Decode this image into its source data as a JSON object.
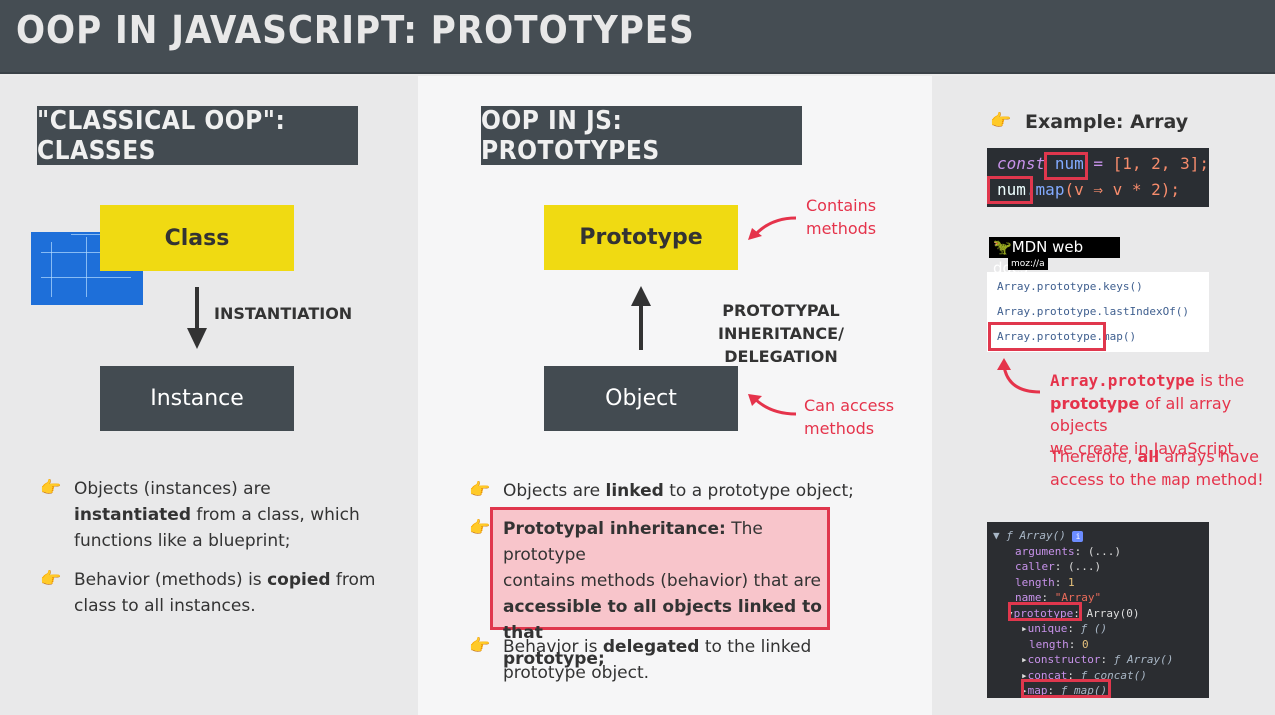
{
  "header": {
    "title": "OOP IN JAVASCRIPT: PROTOTYPES"
  },
  "left": {
    "banner": "\"CLASSICAL OOP\": CLASSES",
    "class_box": "Class",
    "arrow_label": "INSTANTIATION",
    "instance_box": "Instance",
    "bullet1": {
      "p1": "Objects (instances) are",
      "b1": "instantiated",
      "p2": "from a class, which",
      "p3": "functions like a blueprint;"
    },
    "bullet2": {
      "p1": "Behavior (methods) is",
      "b1": "copied",
      "p2": "from",
      "p3": "class to all instances."
    }
  },
  "middle": {
    "banner": "OOP IN JS: PROTOTYPES",
    "prototype_box": "Prototype",
    "object_box": "Object",
    "arrow_label_1": "PROTOTYPAL INHERITANCE/",
    "arrow_label_2": "DELEGATION",
    "contains_1": "Contains",
    "contains_2": "methods",
    "access_1": "Can access",
    "access_2": "methods",
    "bullet1": {
      "p1": "Objects are",
      "b1": "linked",
      "p2": "to a prototype object;"
    },
    "bullet2": {
      "b1": "Prototypal inheritance:",
      "p1": "The prototype",
      "p2": "contains methods (behavior) that are",
      "b2": "accessible to all objects linked to that",
      "b3": "prototype;"
    },
    "bullet3": {
      "p1": "Behavior is",
      "b1": "delegated",
      "p2": "to the linked",
      "p3": "prototype object."
    }
  },
  "right": {
    "example_label": "Example: Array",
    "code": {
      "kw": "const",
      "var": "num",
      "eq": "=",
      "arr": "[1, 2, 3];",
      "l2_var": "num",
      "l2_dot": ".",
      "l2_fn": "map",
      "l2_args": "(v ⇒ v * 2);"
    },
    "mdn": {
      "brand": "MDN web docs",
      "sub": "moz://a",
      "item1": "Array.prototype.keys()",
      "item2": "Array.prototype.lastIndexOf()",
      "item3a": "Array.prototype",
      "item3b": ".map()"
    },
    "note": {
      "l1a": "Array.prototype",
      "l1b": "is the",
      "l2a": "prototype",
      "l2b": "of all array objects",
      "l3": "we create in JavaScript",
      "l4a": "Therefore,",
      "l4b": "all",
      "l4c": "arrays have",
      "l5a": "access to the",
      "l5b": "map",
      "l5c": "method!"
    },
    "console": {
      "l1": "▼ ƒ Array()",
      "l1i": "i",
      "l2k": "arguments",
      "l2v": "(...)",
      "l3k": "caller",
      "l3v": "(...)",
      "l4k": "length",
      "l4v": "1",
      "l5k": "name",
      "l5v": "\"Array\"",
      "l6k": "prototype",
      "l6v": "Array(0)",
      "l7k": "unique",
      "l7v": "ƒ ()",
      "l8k": "length",
      "l8v": "0",
      "l9k": "constructor",
      "l9v": "ƒ Array()",
      "l10k": "concat",
      "l10v": "ƒ concat()",
      "l11k": "map",
      "l11v": "ƒ map()"
    }
  }
}
